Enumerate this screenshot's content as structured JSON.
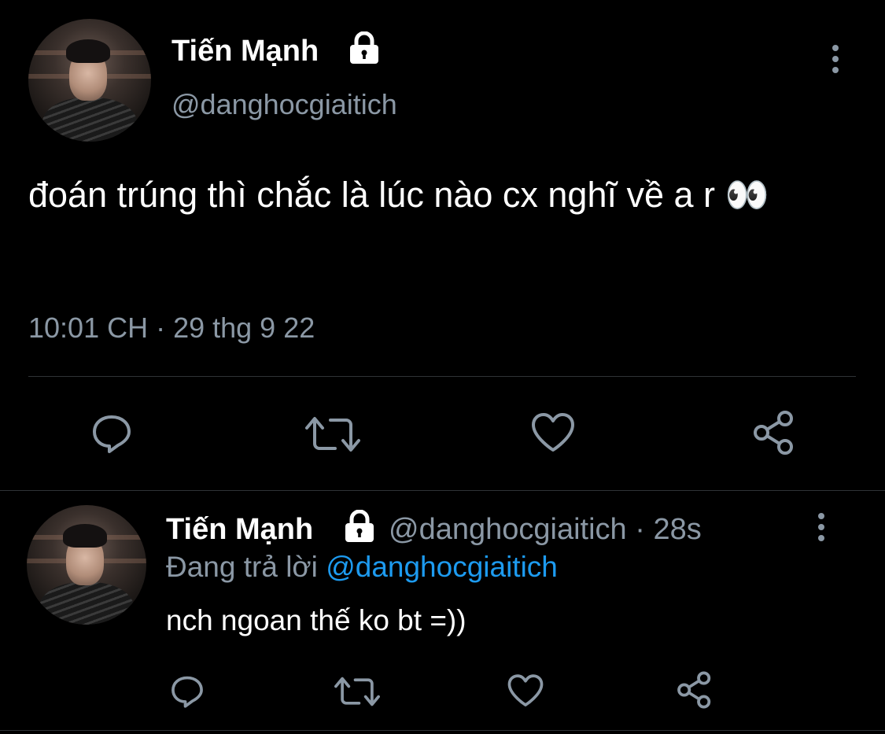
{
  "main_tweet": {
    "author": {
      "name": "Tiến Mạnh",
      "handle": "@danghocgiaitich",
      "avatar": "avatar",
      "protected_icon": "lock-icon"
    },
    "more_icon": "vertical-ellipsis-icon",
    "text": "đoán trúng thì chắc là lúc nào cx nghĩ về a r 👀",
    "timestamp": "10:01 CH · 29 thg 9 22",
    "actions": [
      "reply-icon",
      "retweet-icon",
      "like-icon",
      "share-icon"
    ]
  },
  "reply_tweet": {
    "author": {
      "name": "Tiến Mạnh",
      "handle": "@danghocgiaitich",
      "separator": "·",
      "time_ago": "28s",
      "protected_icon": "lock-icon"
    },
    "replying_to_prefix": "Đang trả lời",
    "replying_to_handle": "@danghocgiaitich",
    "text": "nch ngoan thế ko bt =))",
    "more_icon": "vertical-ellipsis-icon",
    "actions": [
      "reply-icon",
      "retweet-icon",
      "like-icon",
      "share-icon"
    ]
  },
  "colors": {
    "background": "#000000",
    "text_primary": "#ffffff",
    "text_secondary": "#8b98a5",
    "link": "#1d9bf0",
    "divider": "#2f3336"
  }
}
